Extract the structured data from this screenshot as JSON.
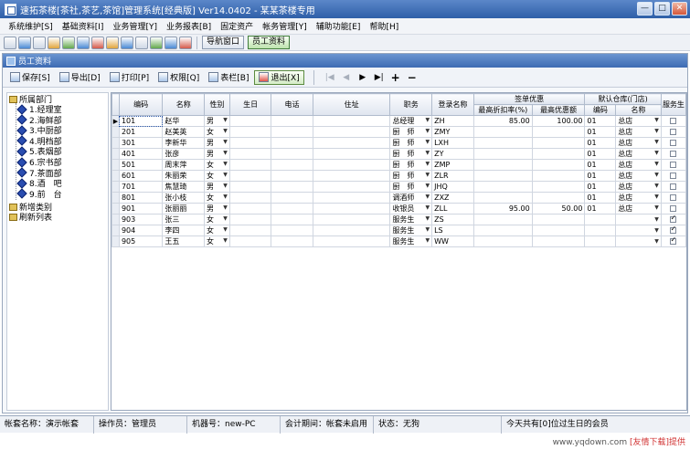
{
  "window": {
    "title": "速拓茶楼[茶社,茶艺,茶馆]管理系统[经典版] Ver14.0402 - 某某茶楼专用",
    "minimize": "—",
    "maximize": "□",
    "close": "✕"
  },
  "menubar": {
    "items": [
      "系统维护[S]",
      "基础资料[I]",
      "业务管理[Y]",
      "业务报表[B]",
      "固定资产",
      "帐务管理[Y]",
      "辅助功能[E]",
      "帮助[H]"
    ]
  },
  "toolbar": {
    "nav_button": "导航窗口",
    "staff_button": "员工资料"
  },
  "panel": {
    "title": "员工资料"
  },
  "actions": {
    "save": "保存[S]",
    "export": "导出[D]",
    "print": "打印[P]",
    "permission": "权限[Q]",
    "columns": "表栏[B]",
    "exit": "退出[X]",
    "first": "|◀",
    "prev": "◀",
    "next": "▶",
    "last": "▶|",
    "add": "+",
    "remove": "−"
  },
  "tree": {
    "root": "所属部门",
    "departments": [
      "1.经理室",
      "2.海鲜部",
      "3.中厨部",
      "4.明档部",
      "5.表烟部",
      "6.宗书部",
      "7.茶面部",
      "8.酒　吧",
      "9.前　台"
    ],
    "add_category": "新增类别",
    "refresh": "刷新列表"
  },
  "grid": {
    "headers": {
      "code": "编码",
      "name": "名称",
      "gender": "性别",
      "birthday": "生日",
      "phone": "电话",
      "address": "住址",
      "position": "职务",
      "login": "登录名称",
      "discount_group": "签单优惠",
      "max_discount_rate": "最高折扣率(%)",
      "max_discount_amount": "最高优惠额",
      "warehouse_group": "默认仓库(门店)",
      "wh_code": "编码",
      "wh_name": "名称",
      "waiter": "服务生"
    },
    "rows": [
      {
        "code": "101",
        "name": "赵华",
        "gender": "男",
        "position": "总经理",
        "login": "ZH",
        "rate": "85.00",
        "amount": "100.00",
        "wh_code": "01",
        "wh_name": "总店",
        "waiter": false,
        "selected": true
      },
      {
        "code": "201",
        "name": "赵美英",
        "gender": "女",
        "position": "厨　师",
        "login": "ZMY",
        "rate": "",
        "amount": "",
        "wh_code": "01",
        "wh_name": "总店",
        "waiter": false
      },
      {
        "code": "301",
        "name": "李新华",
        "gender": "男",
        "position": "厨　师",
        "login": "LXH",
        "rate": "",
        "amount": "",
        "wh_code": "01",
        "wh_name": "总店",
        "waiter": false
      },
      {
        "code": "401",
        "name": "张彦",
        "gender": "男",
        "position": "厨　师",
        "login": "ZY",
        "rate": "",
        "amount": "",
        "wh_code": "01",
        "wh_name": "总店",
        "waiter": false
      },
      {
        "code": "501",
        "name": "周末萍",
        "gender": "女",
        "position": "厨　师",
        "login": "ZMP",
        "rate": "",
        "amount": "",
        "wh_code": "01",
        "wh_name": "总店",
        "waiter": false
      },
      {
        "code": "601",
        "name": "朱丽荣",
        "gender": "女",
        "position": "厨　师",
        "login": "ZLR",
        "rate": "",
        "amount": "",
        "wh_code": "01",
        "wh_name": "总店",
        "waiter": false
      },
      {
        "code": "701",
        "name": "焦慧琦",
        "gender": "男",
        "position": "厨　师",
        "login": "JHQ",
        "rate": "",
        "amount": "",
        "wh_code": "01",
        "wh_name": "总店",
        "waiter": false
      },
      {
        "code": "801",
        "name": "张小枝",
        "gender": "女",
        "position": "调酒师",
        "login": "ZXZ",
        "rate": "",
        "amount": "",
        "wh_code": "01",
        "wh_name": "总店",
        "waiter": false
      },
      {
        "code": "901",
        "name": "张丽丽",
        "gender": "男",
        "position": "收银员",
        "login": "ZLL",
        "rate": "95.00",
        "amount": "50.00",
        "wh_code": "01",
        "wh_name": "总店",
        "waiter": false
      },
      {
        "code": "903",
        "name": "张三",
        "gender": "女",
        "position": "服务生",
        "login": "ZS",
        "rate": "",
        "amount": "",
        "wh_code": "",
        "wh_name": "",
        "waiter": true
      },
      {
        "code": "904",
        "name": "李四",
        "gender": "女",
        "position": "服务生",
        "login": "LS",
        "rate": "",
        "amount": "",
        "wh_code": "",
        "wh_name": "",
        "waiter": true
      },
      {
        "code": "905",
        "name": "王五",
        "gender": "女",
        "position": "服务生",
        "login": "WW",
        "rate": "",
        "amount": "",
        "wh_code": "",
        "wh_name": "",
        "waiter": true
      }
    ]
  },
  "statusbar": {
    "account": "帐套名称：演示帐套",
    "operator": "操作员：管理员",
    "machine": "机器号：new-PC",
    "period": "会计期间：帐套未启用",
    "state": "状态：无狗",
    "birthday": "今天共有[0]位过生日的会员"
  },
  "watermark": {
    "url": "www.yqdown.com",
    "text": "[友情下载]提供"
  }
}
